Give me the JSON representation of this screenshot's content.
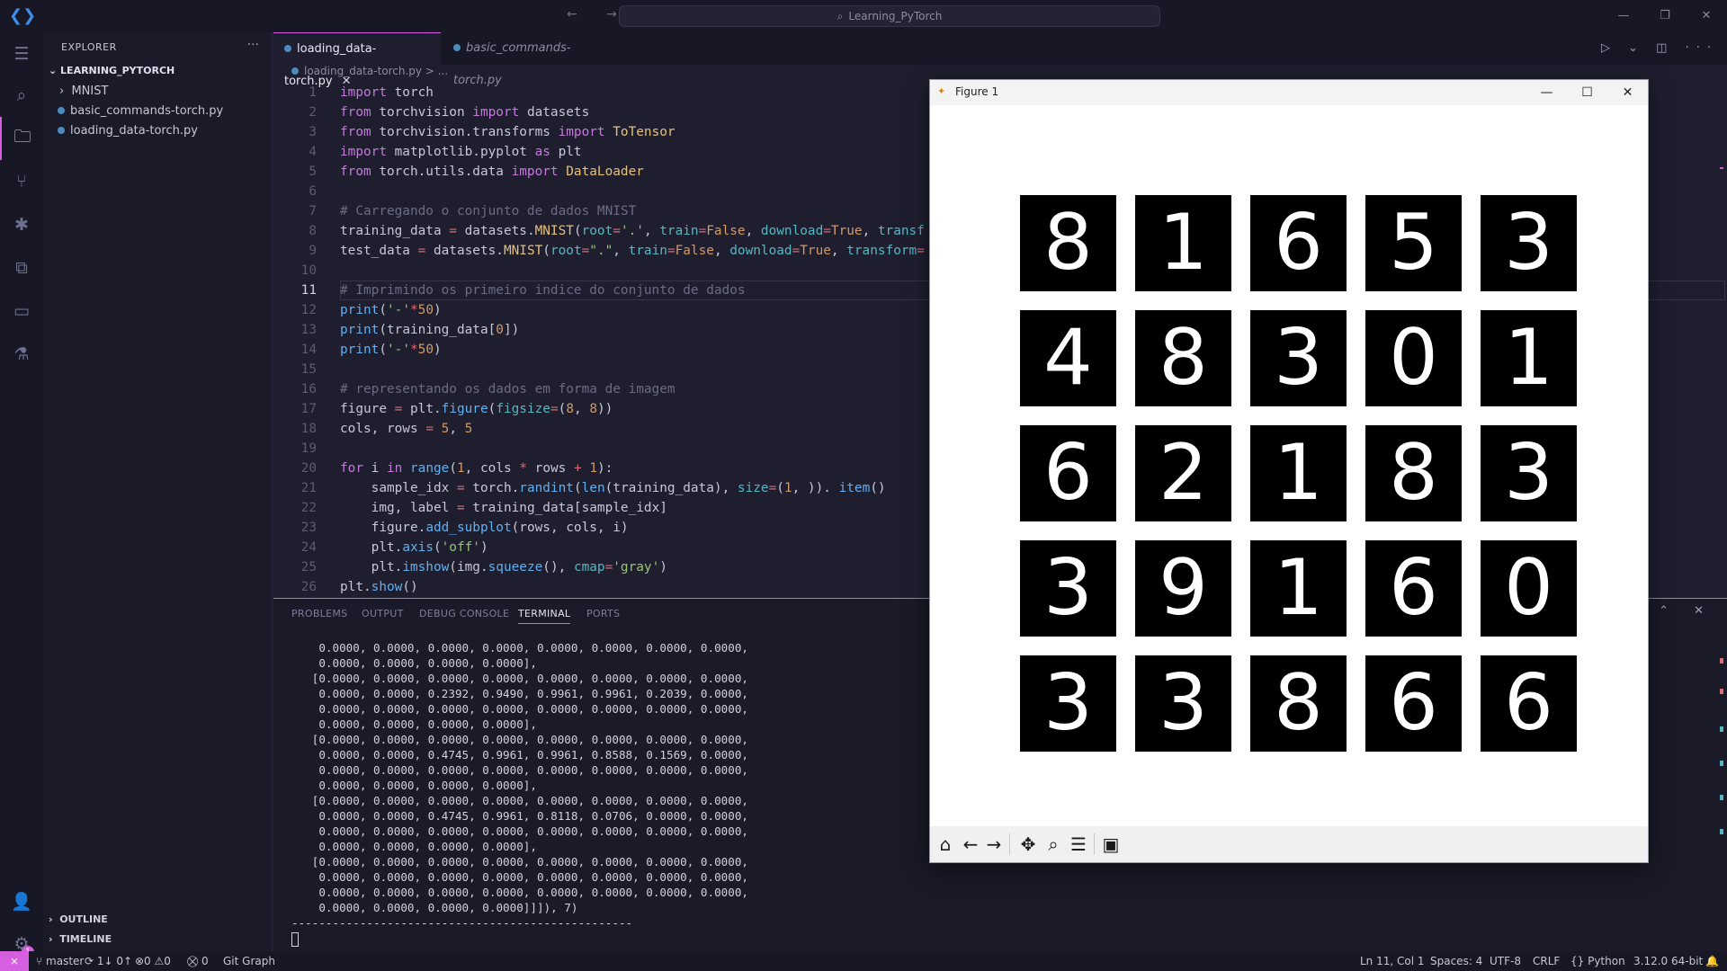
{
  "titlebar": {
    "app_icon": "vscode-logo",
    "nav": "← →",
    "search": "Learning_PyTorch"
  },
  "window_controls": {
    "minimize": "—",
    "restore": "❐",
    "close": "✕"
  },
  "activity": {
    "explorer": "☰",
    "search": "⌕",
    "files": "🗀",
    "git": "⑂",
    "debug": "✱",
    "extensions": "⧉",
    "remote": "▭",
    "testing": "⚗",
    "account": "👤",
    "manage": "⚙",
    "manage_badge": "1"
  },
  "sidebar": {
    "header": "EXPLORER",
    "more": "···",
    "root": "LEARNING_PYTORCH",
    "items": [
      {
        "label": "MNIST",
        "type": "folder"
      },
      {
        "label": "basic_commands-torch.py",
        "type": "file"
      },
      {
        "label": "loading_data-torch.py",
        "type": "file"
      }
    ],
    "outline": "OUTLINE",
    "timeline": "TIMELINE"
  },
  "tabs": [
    {
      "label": "loading_data-torch.py",
      "active": true
    },
    {
      "label": "basic_commands-torch.py",
      "active": false
    }
  ],
  "editor_actions": "▷ ⌄ ◫ ···",
  "breadcrumb": "loading_data-torch.py > ...",
  "panel": {
    "tabs": [
      "PROBLEMS",
      "OUTPUT",
      "DEBUG CONSOLE",
      "TERMINAL",
      "PORTS"
    ],
    "active_tab": "TERMINAL",
    "controls": "··· ⌃ ✕",
    "terminal_lines": [
      "    0.0000, 0.0000, 0.0000, 0.0000, 0.0000, 0.0000, 0.0000, 0.0000,",
      "    0.0000, 0.0000, 0.0000, 0.0000],",
      "   [0.0000, 0.0000, 0.0000, 0.0000, 0.0000, 0.0000, 0.0000, 0.0000,",
      "    0.0000, 0.0000, 0.2392, 0.9490, 0.9961, 0.9961, 0.2039, 0.0000,",
      "    0.0000, 0.0000, 0.0000, 0.0000, 0.0000, 0.0000, 0.0000, 0.0000,",
      "    0.0000, 0.0000, 0.0000, 0.0000],",
      "   [0.0000, 0.0000, 0.0000, 0.0000, 0.0000, 0.0000, 0.0000, 0.0000,",
      "    0.0000, 0.0000, 0.4745, 0.9961, 0.9961, 0.8588, 0.1569, 0.0000,",
      "    0.0000, 0.0000, 0.0000, 0.0000, 0.0000, 0.0000, 0.0000, 0.0000,",
      "    0.0000, 0.0000, 0.0000, 0.0000],",
      "   [0.0000, 0.0000, 0.0000, 0.0000, 0.0000, 0.0000, 0.0000, 0.0000,",
      "    0.0000, 0.0000, 0.4745, 0.9961, 0.8118, 0.0706, 0.0000, 0.0000,",
      "    0.0000, 0.0000, 0.0000, 0.0000, 0.0000, 0.0000, 0.0000, 0.0000,",
      "    0.0000, 0.0000, 0.0000, 0.0000],",
      "   [0.0000, 0.0000, 0.0000, 0.0000, 0.0000, 0.0000, 0.0000, 0.0000,",
      "    0.0000, 0.0000, 0.0000, 0.0000, 0.0000, 0.0000, 0.0000, 0.0000,",
      "    0.0000, 0.0000, 0.0000, 0.0000, 0.0000, 0.0000, 0.0000, 0.0000,",
      "    0.0000, 0.0000, 0.0000, 0.0000]]]), 7)",
      "--------------------------------------------------"
    ]
  },
  "statusbar": {
    "remote": "⨯",
    "branch": "master",
    "sync": "1↓ 0↑",
    "problems": "⊗0 ⚠0",
    "ports": "⛒ 0",
    "git_graph": "Git Graph",
    "position": "Ln 11, Col 1",
    "spaces": "Spaces: 4",
    "encoding": "UTF-8",
    "eol": "CRLF",
    "language": "{} Python",
    "interpreter": "3.12.0 64-bit",
    "bell": "🔔"
  },
  "figure": {
    "title": "Figure 1",
    "digits": [
      "8",
      "1",
      "6",
      "5",
      "3",
      "4",
      "8",
      "3",
      "0",
      "1",
      "6",
      "2",
      "1",
      "8",
      "3",
      "3",
      "9",
      "1",
      "6",
      "0",
      "3",
      "3",
      "8",
      "6",
      "6"
    ],
    "toolbar": [
      "home-icon",
      "back-icon",
      "forward-icon",
      "pan-icon",
      "zoom-icon",
      "configure-icon",
      "save-icon"
    ]
  },
  "colors": {
    "accent": "#d55fde",
    "background": "#1e1e2e"
  }
}
